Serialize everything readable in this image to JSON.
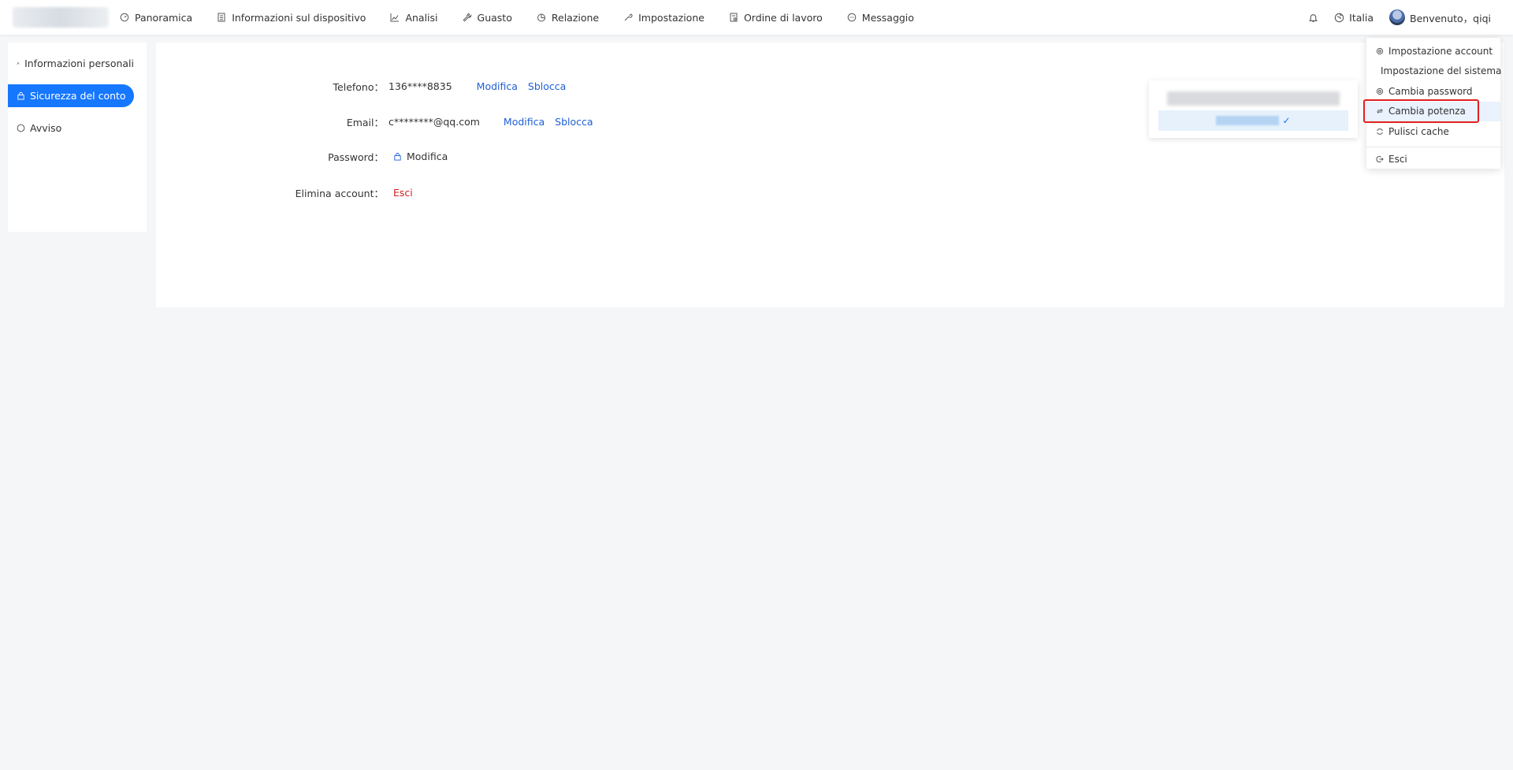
{
  "nav": {
    "items": [
      {
        "label": "Panoramica",
        "icon": "dashboard-icon"
      },
      {
        "label": "Informazioni sul dispositivo",
        "icon": "device-list-icon"
      },
      {
        "label": "Analisi",
        "icon": "line-chart-icon"
      },
      {
        "label": "Guasto",
        "icon": "wrench-icon"
      },
      {
        "label": "Relazione",
        "icon": "pie-chart-icon"
      },
      {
        "label": "Impostazione",
        "icon": "tool-icon"
      },
      {
        "label": "Ordine di lavoro",
        "icon": "work-order-icon"
      },
      {
        "label": "Messaggio",
        "icon": "message-icon"
      }
    ]
  },
  "topright": {
    "region_label": "Italia",
    "welcome": "Benvenuto，qiqi"
  },
  "sidebar": {
    "items": [
      {
        "label": "Informazioni personali",
        "icon": "user-icon"
      },
      {
        "label": "Sicurezza del conto",
        "icon": "lock-icon",
        "active": true
      },
      {
        "label": "Avviso",
        "icon": "message-icon"
      }
    ]
  },
  "security": {
    "phone_label": "Telefono：",
    "phone_value": "136****8835",
    "email_label": "Email：",
    "email_value": "c********@qq.com",
    "password_label": "Password：",
    "delete_label": "Elimina account：",
    "modify": "Modifica",
    "unbind": "Sblocca",
    "logout": "Esci"
  },
  "user_menu": {
    "items": [
      {
        "label": "Impostazione account",
        "icon": "gear-icon"
      },
      {
        "label": "Impostazione del sistema",
        "icon": "tool-icon"
      },
      {
        "label": "Cambia password",
        "icon": "gear-icon"
      },
      {
        "label": "Cambia potenza",
        "icon": "switch-icon",
        "highlighted": true
      },
      {
        "label": "Pulisci cache",
        "icon": "refresh-icon"
      },
      {
        "label": "Esci",
        "icon": "logout-icon"
      }
    ]
  },
  "colors": {
    "primary": "#1677ff",
    "link": "#1f5fd6",
    "danger": "#d21f1f",
    "highlight_border": "#e02020"
  }
}
